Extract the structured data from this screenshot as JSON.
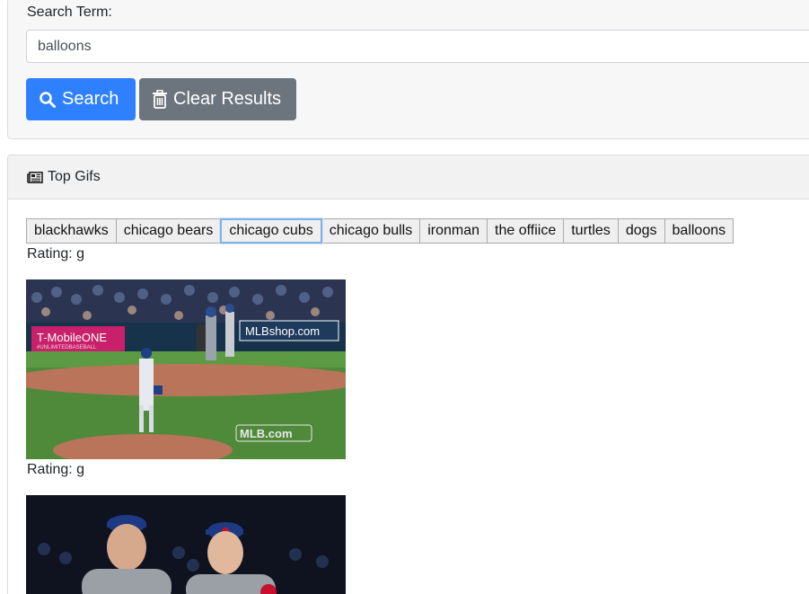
{
  "search": {
    "label": "Search Term:",
    "value": "balloons",
    "search_button": "Search",
    "clear_button": "Clear Results"
  },
  "panel": {
    "title": "Top Gifs",
    "icon": "newspaper-icon"
  },
  "tags": [
    "blackhawks",
    "chicago bears",
    "chicago cubs",
    "chicago bulls",
    "ironman",
    "the offiice",
    "turtles",
    "dogs",
    "balloons"
  ],
  "focused_tag": "chicago cubs",
  "results": [
    {
      "rating": "Rating: g",
      "overlay": {
        "board_left": "T-MobileONE",
        "board_left_sub": "#UNLIMITEDBASEBALL",
        "board_right": "MLBshop.com",
        "watermark": "MLB.com"
      }
    },
    {
      "rating": "Rating: g"
    }
  ],
  "colors": {
    "primary": "#2f80ff",
    "secondary": "#6c757d",
    "field_green": "#4f8a3a",
    "dirt": "#b9745a"
  }
}
